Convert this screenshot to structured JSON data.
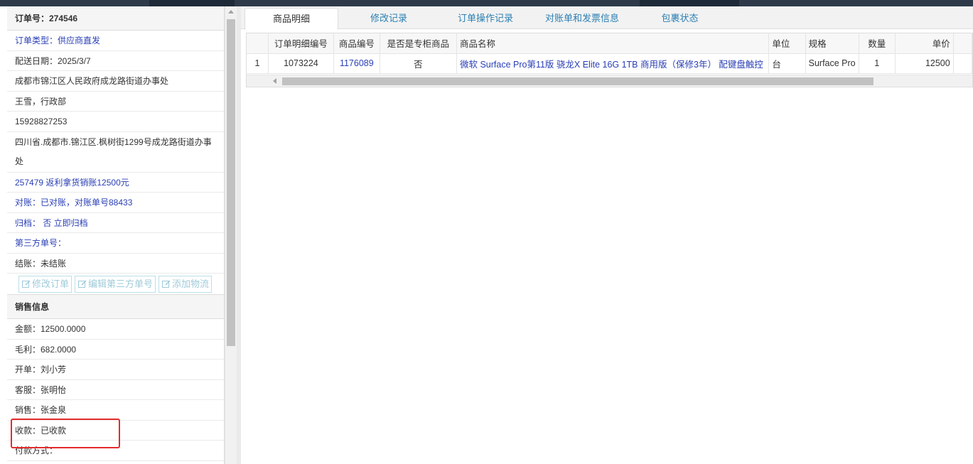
{
  "order": {
    "order_no": "订单号：274546",
    "type": "订单类型：供应商直发",
    "delivery_date": "配送日期：2025/3/7",
    "address_1": "成都市锦江区人民政府成龙路街道办事处",
    "contact": "王雪，行政部",
    "phone": "15928827253",
    "address_2": "四川省.成都市.锦江区.枫树街1299号成龙路街道办事处",
    "rebate": "257479 返利拿货销账12500元",
    "reconcile": "对账：已对账，对账单号88433",
    "archive": "归档： 否 立即归档",
    "third_party": "第三方单号：",
    "settle": "结账：未结账",
    "buttons": [
      "修改订单",
      "编辑第三方单号",
      "添加物流"
    ]
  },
  "sales": {
    "title": "销售信息",
    "amount": "金额：12500.0000",
    "gross_profit": "毛利：682.0000",
    "issuer": "开单：刘小芳",
    "service": "客服：张明怡",
    "seller": "销售：张金泉",
    "payment": "收款：已收款",
    "payment_method": "付款方式："
  },
  "tabs": [
    "商品明细",
    "修改记录",
    "订单操作记录",
    "对账单和发票信息",
    "包裹状态"
  ],
  "grid": {
    "headers": [
      "",
      "订单明细编号",
      "商品编号",
      "是否是专柜商品",
      "商品名称",
      "单位",
      "规格",
      "数量",
      "单价"
    ],
    "rows": [
      [
        "1",
        "1073224",
        "1176089",
        "否",
        "微软 Surface Pro第11版 骁龙X Elite 16G 1TB 商用版（保修3年） 配键盘触控",
        "台",
        "Surface Pro",
        "1",
        "12500"
      ]
    ]
  },
  "colors": {
    "link": "#2a3fb5",
    "tab_text": "#2b7fb3",
    "highlight": "#e52b2b",
    "button_text": "#9fcbd9"
  }
}
